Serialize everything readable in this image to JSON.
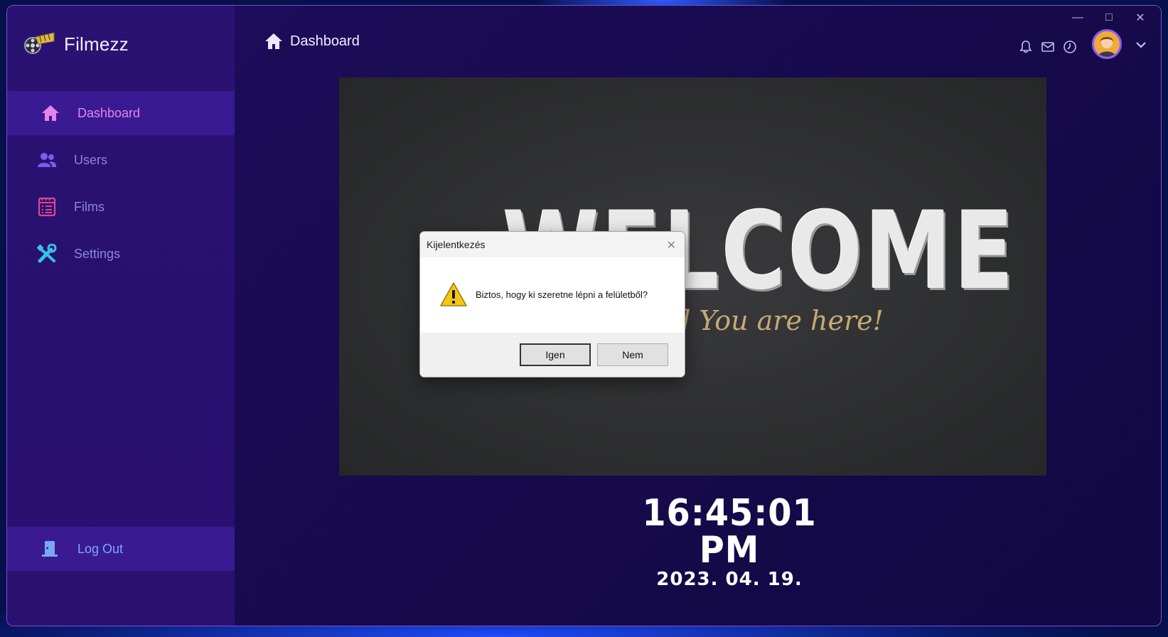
{
  "app": {
    "name": "Filmezz"
  },
  "sidebar": {
    "items": [
      {
        "label": "Dashboard",
        "icon": "home-icon",
        "active": true,
        "color": "#e585ea"
      },
      {
        "label": "Users",
        "icon": "users-icon",
        "active": false,
        "color": "#7a5cf0"
      },
      {
        "label": "Films",
        "icon": "film-list-icon",
        "active": false,
        "color": "#e0458a"
      },
      {
        "label": "Settings",
        "icon": "tools-icon",
        "active": false,
        "color": "#34c3e8"
      }
    ],
    "logout": {
      "label": "Log Out",
      "icon": "door-icon",
      "color": "#7ba8f0"
    }
  },
  "header": {
    "title": "Dashboard",
    "icons": [
      "bell-icon",
      "mail-icon",
      "clock-icon"
    ]
  },
  "banner": {
    "title": "WELCOME",
    "subtitle": "d You are here!"
  },
  "clock": {
    "time": "16:45:01 PM",
    "date": "2023. 04. 19."
  },
  "dialog": {
    "title": "Kijelentkezés",
    "message": "Biztos, hogy ki szeretne lépni a felületből?",
    "yes_label": "Igen",
    "no_label": "Nem"
  },
  "colors": {
    "sidebar_bg": "#2a1273",
    "active_bg": "#3a1a92",
    "main_bg": "#1a0b4f",
    "accent_border": "#7c4dd6"
  }
}
